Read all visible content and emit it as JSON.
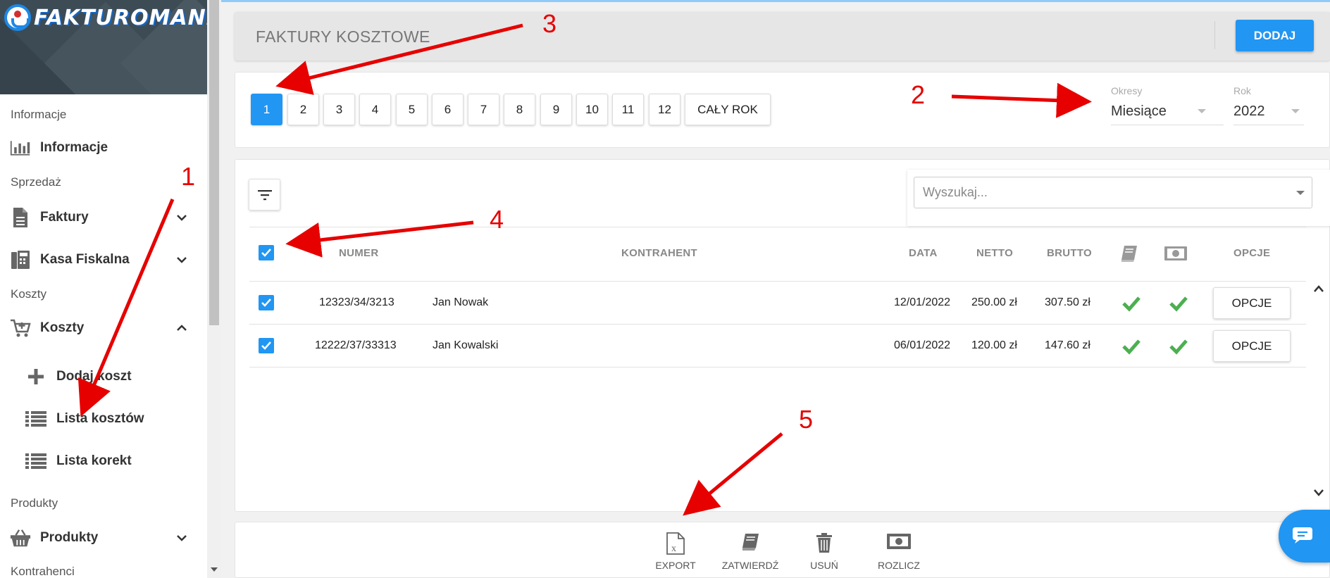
{
  "app": {
    "logo_text": "FAKTUROMANIA"
  },
  "sidebar": {
    "sections": [
      {
        "label": "Informacje"
      },
      {
        "label": "Sprzedaż"
      },
      {
        "label": "Koszty"
      },
      {
        "label": "Produkty"
      },
      {
        "label": "Kontrahenci"
      }
    ],
    "items": [
      {
        "label": "Informacje",
        "icon": "bar-chart-icon"
      },
      {
        "label": "Faktury",
        "icon": "document-icon"
      },
      {
        "label": "Kasa Fiskalna",
        "icon": "cash-register-icon"
      },
      {
        "label": "Koszty",
        "icon": "cart-add-icon"
      },
      {
        "label": "Dodaj koszt",
        "icon": "plus-icon"
      },
      {
        "label": "Lista kosztów",
        "icon": "list-icon"
      },
      {
        "label": "Lista korekt",
        "icon": "list-icon"
      },
      {
        "label": "Produkty",
        "icon": "basket-icon"
      }
    ]
  },
  "header": {
    "title": "FAKTURY KOSZTOWE",
    "add_label": "DODAJ"
  },
  "period": {
    "months": [
      "1",
      "2",
      "3",
      "4",
      "5",
      "6",
      "7",
      "8",
      "9",
      "10",
      "11",
      "12"
    ],
    "active_month": "1",
    "whole_year_label": "CAŁY ROK",
    "periods_label": "Okresy",
    "periods_value": "Miesiące",
    "year_label": "Rok",
    "year_value": "2022"
  },
  "search": {
    "placeholder": "Wyszukaj..."
  },
  "table": {
    "headers": {
      "numer": "NUMER",
      "kontrahent": "KONTRAHENT",
      "data": "DATA",
      "netto": "NETTO",
      "brutto": "BRUTTO",
      "opcje": "OPCJE"
    },
    "rows": [
      {
        "numer": "12323/34/3213",
        "kontrahent": "Jan Nowak",
        "data": "12/01/2022",
        "netto": "250.00 zł",
        "brutto": "307.50 zł",
        "options_label": "OPCJE"
      },
      {
        "numer": "12222/37/33313",
        "kontrahent": "Jan Kowalski",
        "data": "06/01/2022",
        "netto": "120.00 zł",
        "brutto": "147.60 zł",
        "options_label": "OPCJE"
      }
    ]
  },
  "actions": [
    {
      "label": "EXPORT",
      "icon": "excel-export-icon"
    },
    {
      "label": "ZATWIERDŹ",
      "icon": "book-icon"
    },
    {
      "label": "USUŃ",
      "icon": "trash-icon"
    },
    {
      "label": "ROZLICZ",
      "icon": "money-icon"
    }
  ],
  "annotations": [
    "1",
    "2",
    "3",
    "4",
    "5"
  ],
  "colors": {
    "accent": "#2196f3",
    "check_green": "#4caf50",
    "annotation_red": "#e60000",
    "sidebar_header": "#3d4b55"
  }
}
